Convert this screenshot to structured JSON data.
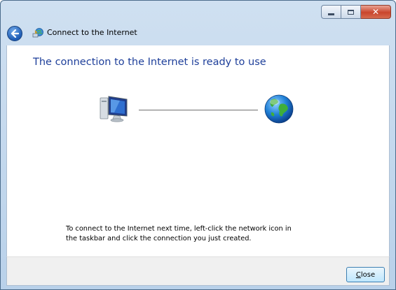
{
  "window": {
    "title": "Connect to the Internet",
    "controls": {
      "minimize_icon": "minimize-icon",
      "maximize_icon": "maximize-icon",
      "close_icon": "close-icon",
      "close_glyph": "✕"
    },
    "accent_close_color": "#c9452c"
  },
  "nav": {
    "back_icon": "back-arrow-icon",
    "wizard_icon": "network-connect-icon"
  },
  "main": {
    "heading": "The connection to the Internet is ready to use",
    "diagram": {
      "computer_icon": "computer-icon",
      "internet_icon": "globe-icon"
    },
    "instructions_line1": "To connect to the Internet next time, left-click the network icon in",
    "instructions_line2": "the taskbar and click the connection you just created.",
    "heading_color": "#1e3f9a"
  },
  "footer": {
    "close_label_underlined": "C",
    "close_label_rest": "lose"
  }
}
